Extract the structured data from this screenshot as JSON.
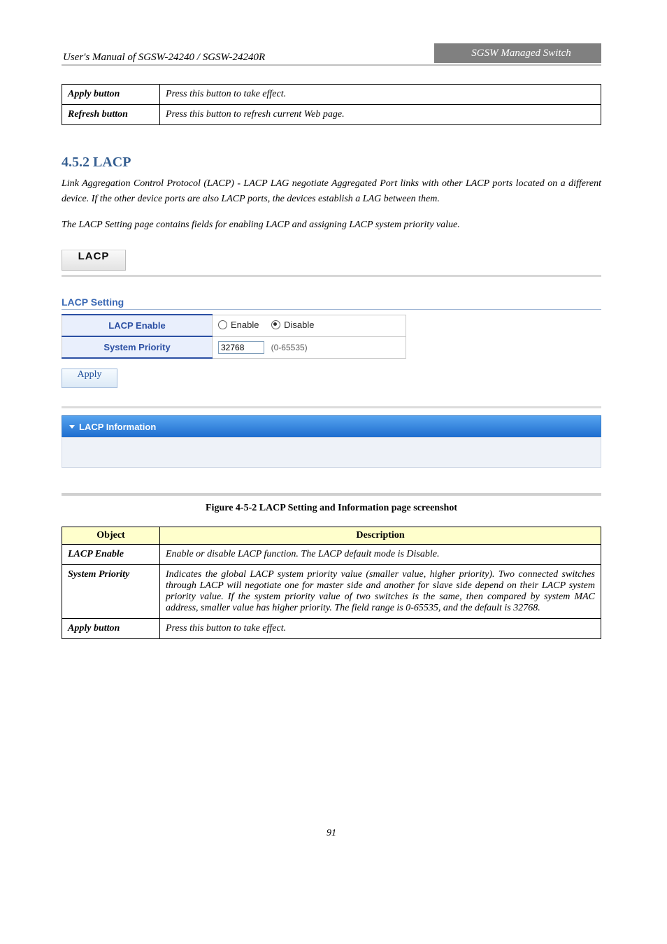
{
  "header": {
    "left": "User's Manual of SGSW-24240 / SGSW-24240R",
    "right": "SGSW Managed Switch"
  },
  "def_table_top": {
    "rows": [
      {
        "title": "Apply button",
        "desc": "Press this button to take effect."
      },
      {
        "title": "Refresh button",
        "desc": "Press this button to refresh current Web page."
      }
    ]
  },
  "section": {
    "heading": "4.5.2 LACP",
    "p1": "Link Aggregation Control Protocol (LACP) - LACP LAG negotiate Aggregated Port links with other LACP ports located on a different device. If the other device ports are also LACP ports, the devices establish a LAG between them.",
    "p2": "The LACP Setting page contains fields for enabling LACP and assigning LACP system priority value."
  },
  "figure": {
    "tab_label": "LACP",
    "setting_title": "LACP Setting",
    "row1_label": "LACP Enable",
    "enable_label": "Enable",
    "disable_label": "Disable",
    "row2_label": "System Priority",
    "sp_value": "32768",
    "sp_hint": "(0-65535)",
    "apply_label": "Apply",
    "panel_title": "LACP Information",
    "caption": "Figure 4-5-2 LACP Setting and Information page screenshot"
  },
  "def_table_bottom": {
    "head_obj": "Object",
    "head_desc": "Description",
    "rows": [
      {
        "title": "LACP Enable",
        "desc": "Enable or disable LACP function. The LACP default mode is Disable."
      },
      {
        "title": "System Priority",
        "desc": "Indicates the global LACP system priority value (smaller value, higher priority). Two connected switches through LACP will negotiate one for master side and another for slave side depend on their LACP system priority value. If the system priority value of two switches is the same, then compared by system MAC address, smaller value has higher priority. The field range is 0-65535, and the default is 32768."
      },
      {
        "title": "Apply button",
        "desc": "Press this button to take effect."
      }
    ]
  },
  "footer": {
    "page": "91"
  }
}
